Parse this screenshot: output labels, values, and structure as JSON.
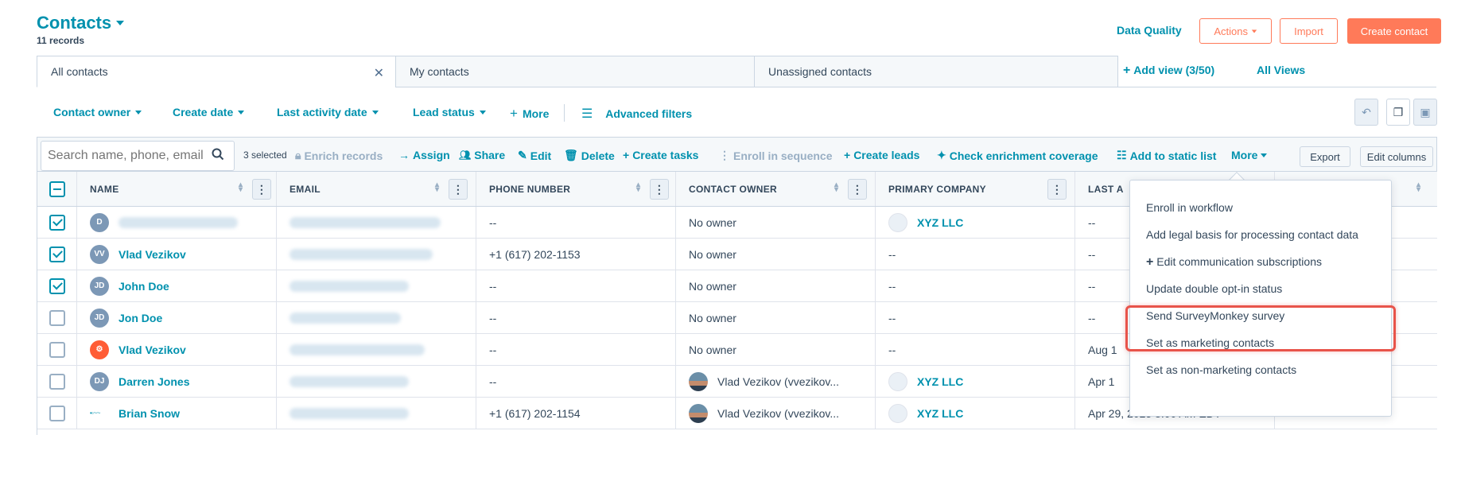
{
  "header": {
    "title": "Contacts",
    "records": "11 records",
    "data_quality": "Data Quality",
    "actions": "Actions",
    "import": "Import",
    "create_contact": "Create contact"
  },
  "tabs": [
    {
      "label": "All contacts"
    },
    {
      "label": "My contacts"
    },
    {
      "label": "Unassigned contacts"
    }
  ],
  "add_view": "Add view (3/50)",
  "all_views": "All Views",
  "filters": {
    "contact_owner": "Contact owner",
    "create_date": "Create date",
    "last_activity_date": "Last activity date",
    "lead_status": "Lead status",
    "more": "More",
    "advanced": "Advanced filters"
  },
  "bulk": {
    "search_placeholder": "Search name, phone, email",
    "selected": "3 selected",
    "enrich": "Enrich records",
    "assign": "Assign",
    "share": "Share",
    "edit": "Edit",
    "delete": "Delete",
    "create_tasks": "Create tasks",
    "enroll_sequence": "Enroll in sequence",
    "create_leads": "Create leads",
    "check_enrichment": "Check enrichment coverage",
    "add_static_list": "Add to static list",
    "more": "More",
    "export": "Export",
    "edit_columns": "Edit columns"
  },
  "columns": [
    "NAME",
    "EMAIL",
    "PHONE NUMBER",
    "CONTACT OWNER",
    "PRIMARY COMPANY",
    "LAST A"
  ],
  "rows": [
    {
      "initials": "D",
      "name": "",
      "phone": "--",
      "owner": "No owner",
      "company": "XYZ LLC",
      "last": "--"
    },
    {
      "initials": "VV",
      "name": "Vlad Vezikov",
      "phone": "+1 (617) 202-1153",
      "owner": "No owner",
      "company": "--",
      "last": "--"
    },
    {
      "initials": "JD",
      "name": "John Doe",
      "phone": "--",
      "owner": "No owner",
      "company": "--",
      "last": "--"
    },
    {
      "initials": "JD",
      "name": "Jon Doe",
      "phone": "--",
      "owner": "No owner",
      "company": "--",
      "last": "--"
    },
    {
      "initials": "",
      "name": "Vlad Vezikov",
      "phone": "--",
      "owner": "No owner",
      "company": "--",
      "last": "Aug 1"
    },
    {
      "initials": "DJ",
      "name": "Darren Jones",
      "phone": "--",
      "owner": "Vlad Vezikov (vvezikov...",
      "company": "XYZ LLC",
      "last": "Apr 1"
    },
    {
      "initials": "",
      "name": "Brian Snow",
      "phone": "+1 (617) 202-1154",
      "owner": "Vlad Vezikov (vvezikov...",
      "company": "XYZ LLC",
      "last": "Apr 29, 2025 8:00 AM EDT",
      "extra": "--"
    }
  ],
  "more_menu": [
    "Enroll in workflow",
    "Add legal basis for processing contact data",
    "Edit communication subscriptions",
    "Update double opt-in status",
    "Send SurveyMonkey survey",
    "Set as marketing contacts",
    "Set as non-marketing contacts"
  ],
  "colors": {
    "accent": "#0091ae",
    "brand": "#ff7a59",
    "highlight": "#e8534a"
  }
}
